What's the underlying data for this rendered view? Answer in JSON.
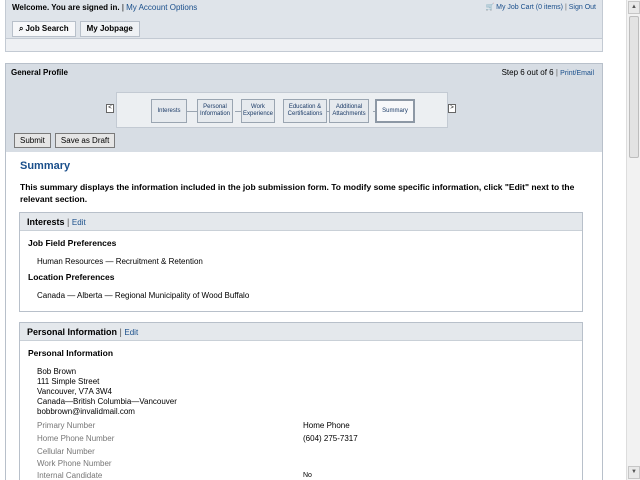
{
  "header": {
    "welcome": "Welcome. You are signed in.",
    "separator": "|",
    "my_account": "My Account Options",
    "job_cart": "My Job Cart (0 items)",
    "sign_out": "Sign Out"
  },
  "tabs": [
    {
      "label": "Job Search",
      "icon": "search-icon"
    },
    {
      "label": "My Jobpage"
    }
  ],
  "panel": {
    "title": "General Profile",
    "step_text": "Step 6 out of 6",
    "print_email": "Print/Email",
    "steps": [
      {
        "label": "Interests"
      },
      {
        "label": "Personal Information"
      },
      {
        "label": "Work Experience"
      },
      {
        "label": "Education & Certifications"
      },
      {
        "label": "Additional Attachments"
      },
      {
        "label": "Summary",
        "current": true
      }
    ],
    "prev_arrow": "<",
    "next_arrow": ">",
    "submit": "Submit",
    "save_draft": "Save as Draft"
  },
  "summary": {
    "title": "Summary",
    "description": "This summary displays the information included in the job submission form. To modify some specific information, click \"Edit\" next to the relevant section."
  },
  "interests": {
    "title": "Interests",
    "edit": "Edit",
    "job_field_heading": "Job Field Preferences",
    "job_field_value": "Human Resources — Recruitment & Retention",
    "location_heading": "Location Preferences",
    "location_value": "Canada — Alberta — Regional Municipality of Wood Buffalo"
  },
  "personal": {
    "title": "Personal Information",
    "edit": "Edit",
    "subheading": "Personal Information",
    "name": "Bob Brown",
    "street": "111 Simple Street",
    "city": "Vancouver, V7A 3W4",
    "region": "Canada—British Columbia—Vancouver",
    "email": "bobbrown@invalidmail.com",
    "fields": [
      {
        "label": "Primary Number",
        "value": "Home Phone"
      },
      {
        "label": "Home Phone Number",
        "value": "(604) 275-7317"
      },
      {
        "label": "Cellular Number",
        "value": ""
      },
      {
        "label": "Work Phone Number",
        "value": ""
      },
      {
        "label": "Internal Candidate",
        "value": "No"
      }
    ]
  }
}
